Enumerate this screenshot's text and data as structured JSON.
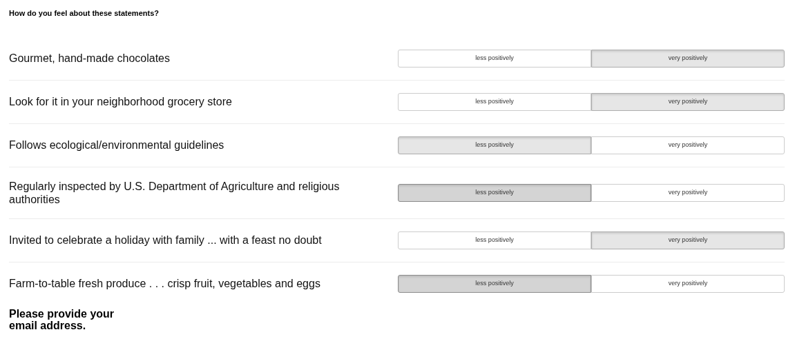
{
  "question": "How do you feel about these statements?",
  "statements": [
    {
      "label": "Gourmet, hand-made chocolates",
      "options": [
        {
          "label": "less positively",
          "selected": false,
          "pressed": false
        },
        {
          "label": "very positively",
          "selected": true,
          "pressed": false
        }
      ]
    },
    {
      "label": "Look for it in your neighborhood grocery store",
      "options": [
        {
          "label": "less positively",
          "selected": false,
          "pressed": false
        },
        {
          "label": "very positively",
          "selected": true,
          "pressed": false
        }
      ]
    },
    {
      "label": "Follows ecological/environmental guidelines",
      "options": [
        {
          "label": "less positively",
          "selected": true,
          "pressed": false
        },
        {
          "label": "very positively",
          "selected": false,
          "pressed": false
        }
      ]
    },
    {
      "label": "Regularly inspected by U.S. Department of Agriculture and religious authorities",
      "options": [
        {
          "label": "less positively",
          "selected": true,
          "pressed": true
        },
        {
          "label": "very positively",
          "selected": false,
          "pressed": false
        }
      ]
    },
    {
      "label": "Invited to celebrate a holiday with family ... with a feast no doubt",
      "options": [
        {
          "label": "less positively",
          "selected": false,
          "pressed": false
        },
        {
          "label": "very positively",
          "selected": true,
          "pressed": false
        }
      ]
    },
    {
      "label": "Farm-to-table fresh produce . . . crisp fruit, vegetables and eggs",
      "options": [
        {
          "label": "less positively",
          "selected": true,
          "pressed": true
        },
        {
          "label": "very positively",
          "selected": false,
          "pressed": false
        }
      ]
    }
  ],
  "email_prompt": "Please provide your email address."
}
